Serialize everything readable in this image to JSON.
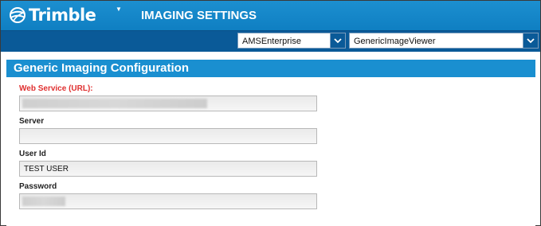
{
  "header": {
    "brand": "Trimble",
    "title": "IMAGING SETTINGS",
    "menu_caret": "▼",
    "color": "#1a8fd0"
  },
  "selectors": {
    "environment": {
      "value": "AMSEnterprise"
    },
    "viewer": {
      "value": "GenericImageViewer"
    }
  },
  "panel": {
    "title": "Generic Imaging Configuration",
    "fields": {
      "web_service": {
        "label": "Web Service (URL):",
        "value": "",
        "required_color": "#e03030"
      },
      "server": {
        "label": "Server",
        "value": ""
      },
      "user_id": {
        "label": "User Id",
        "value": "TEST USER"
      },
      "password": {
        "label": "Password",
        "value": ""
      }
    }
  }
}
